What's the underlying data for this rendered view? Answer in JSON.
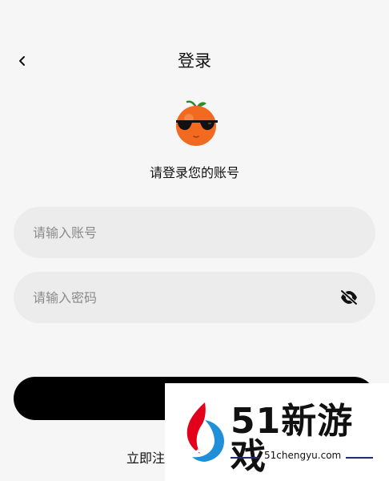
{
  "header": {
    "back_icon": "chevron-left-icon",
    "title": "登录"
  },
  "mascot": {
    "icon": "orange-with-sunglasses-avatar",
    "colors": {
      "body": "#f26a1f",
      "leaf": "#2e8b2e",
      "glasses": "#111111"
    }
  },
  "subtitle": "请登录您的账号",
  "account": {
    "placeholder": "请输入账号",
    "value": ""
  },
  "password": {
    "placeholder": "请输入密码",
    "value": "",
    "toggle_icon": "eye-off-icon"
  },
  "login_button": {
    "color": "#000000"
  },
  "register_link": "立即注",
  "watermark": {
    "brand": "51新游戏",
    "url": "51chengyu.com",
    "colors": {
      "red": "#e3001b",
      "blue": "#1e8fd8",
      "navy": "#1d2c6a"
    }
  }
}
